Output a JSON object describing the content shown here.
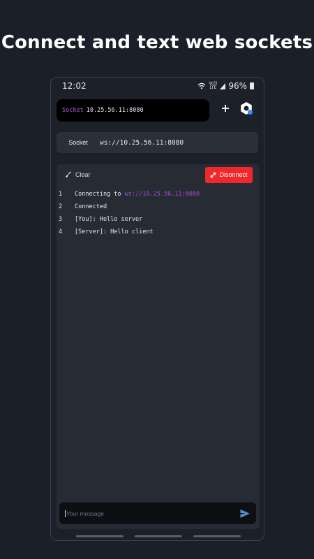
{
  "headline": "Connect and text web sockets",
  "status_bar": {
    "time": "12:02",
    "network_top": "Vo))",
    "network_bottom": "LTE",
    "battery": "96%"
  },
  "socket_selector": {
    "keyword": "Socket",
    "address": "10.25.56.11:8080"
  },
  "url_bar": {
    "label": "Socket",
    "value": "ws://10.25.56.11:8080"
  },
  "console": {
    "clear_label": "Clear",
    "disconnect_label": "Disonnect",
    "lines": [
      {
        "num": "1",
        "text": "Connecting to ",
        "url": "ws://10.25.56.11:8080"
      },
      {
        "num": "2",
        "text": "Connected"
      },
      {
        "num": "3",
        "text": "[You]: Hello server"
      },
      {
        "num": "4",
        "text": "[Server]: Hello client"
      }
    ]
  },
  "message": {
    "placeholder": "Your message",
    "value": ""
  },
  "colors": {
    "accent_purple": "#a24fd0",
    "disconnect_red": "#f0282a",
    "badge_blue": "#3d8bff",
    "send_blue": "#5b8fd8"
  },
  "icons": [
    "wifi-icon",
    "battery-icon",
    "plus-icon",
    "gear-icon",
    "broom-icon",
    "unlink-icon",
    "send-icon"
  ]
}
